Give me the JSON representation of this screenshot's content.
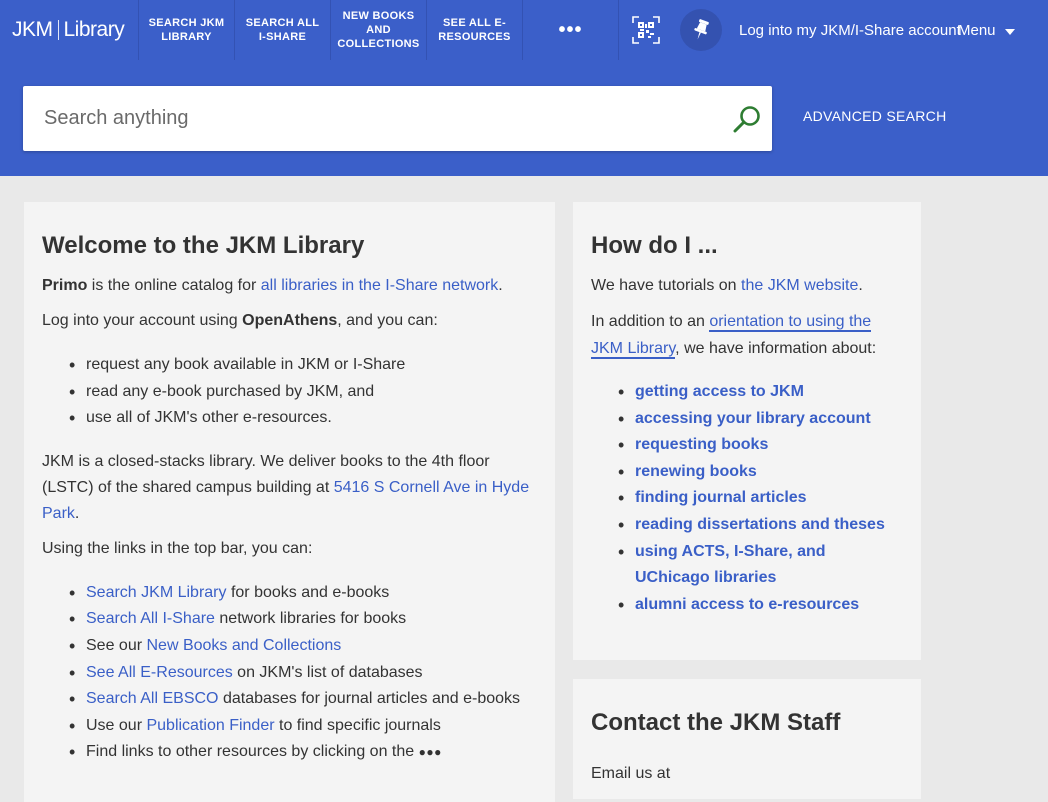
{
  "topbar": {
    "logo_left": "JKM",
    "logo_right": "Library",
    "nav": [
      {
        "label": "SEARCH JKM LIBRARY"
      },
      {
        "label": "SEARCH ALL I-SHARE"
      },
      {
        "label": "NEW BOOKS AND COLLECTIONS"
      },
      {
        "label": "SEE ALL E-RESOURCES"
      }
    ],
    "more_label": "•••",
    "login_label": "Log into my JKM/I-Share account",
    "menu_label": "Menu"
  },
  "search": {
    "placeholder": "Search anything",
    "advanced_label": "ADVANCED SEARCH"
  },
  "welcome": {
    "title": "Welcome to the JKM Library",
    "p1": {
      "bold": "Primo",
      "text": " is the online catalog for ",
      "link": "all libraries in the I-Share network",
      "end": "."
    },
    "p2": {
      "text": "Log into your account using ",
      "bold": "OpenAthens",
      "end": ", and you can:"
    },
    "list1": [
      "request any book available in JKM or I-Share",
      "read any e-book purchased by JKM, and",
      "use all of JKM's other e-resources."
    ],
    "p3": {
      "text": "JKM is a closed-stacks library. We deliver books to the 4th floor (LSTC) of the shared campus building at ",
      "link": "5416 S Cornell Ave in Hyde Park",
      "end": "."
    },
    "p4": "Using the links in the top bar, you can:",
    "list2": [
      {
        "pre": "",
        "link": "Search JKM Library",
        "post": " for books and e-books"
      },
      {
        "pre": "",
        "link": "Search All I-Share",
        "post": " network libraries for books"
      },
      {
        "pre": "See our ",
        "link": "New Books and Collections",
        "post": ""
      },
      {
        "pre": "",
        "link": "See All E-Resources",
        "post": " on JKM's list of databases"
      },
      {
        "pre": "",
        "link": "Search All EBSCO",
        "post": " databases for journal articles and e-books"
      },
      {
        "pre": "Use our ",
        "link": "Publication Finder",
        "post": " to find specific journals"
      },
      {
        "pre": "Find links to other resources by clicking on the ",
        "link": "",
        "post": "●●●"
      }
    ]
  },
  "howdoi": {
    "title": "How do I ...",
    "p1": {
      "text": "We have tutorials on ",
      "link": "the JKM website",
      "end": "."
    },
    "p2": {
      "text": "In addition to an ",
      "link": "orientation to using the JKM Library",
      "end": ", we have information about:"
    },
    "links": [
      "getting access to JKM",
      "accessing your library account",
      "requesting books",
      "renewing books",
      "finding journal articles",
      "reading dissertations and theses",
      "using ACTS, I-Share, and UChicago libraries",
      "alumni access to e-resources"
    ]
  },
  "contact": {
    "title": "Contact the JKM Staff",
    "email_label": "Email us at"
  },
  "colors": {
    "brand_blue": "#3b5fc9",
    "link_blue": "#3a5fc7",
    "search_icon_green": "#2e7d32"
  }
}
